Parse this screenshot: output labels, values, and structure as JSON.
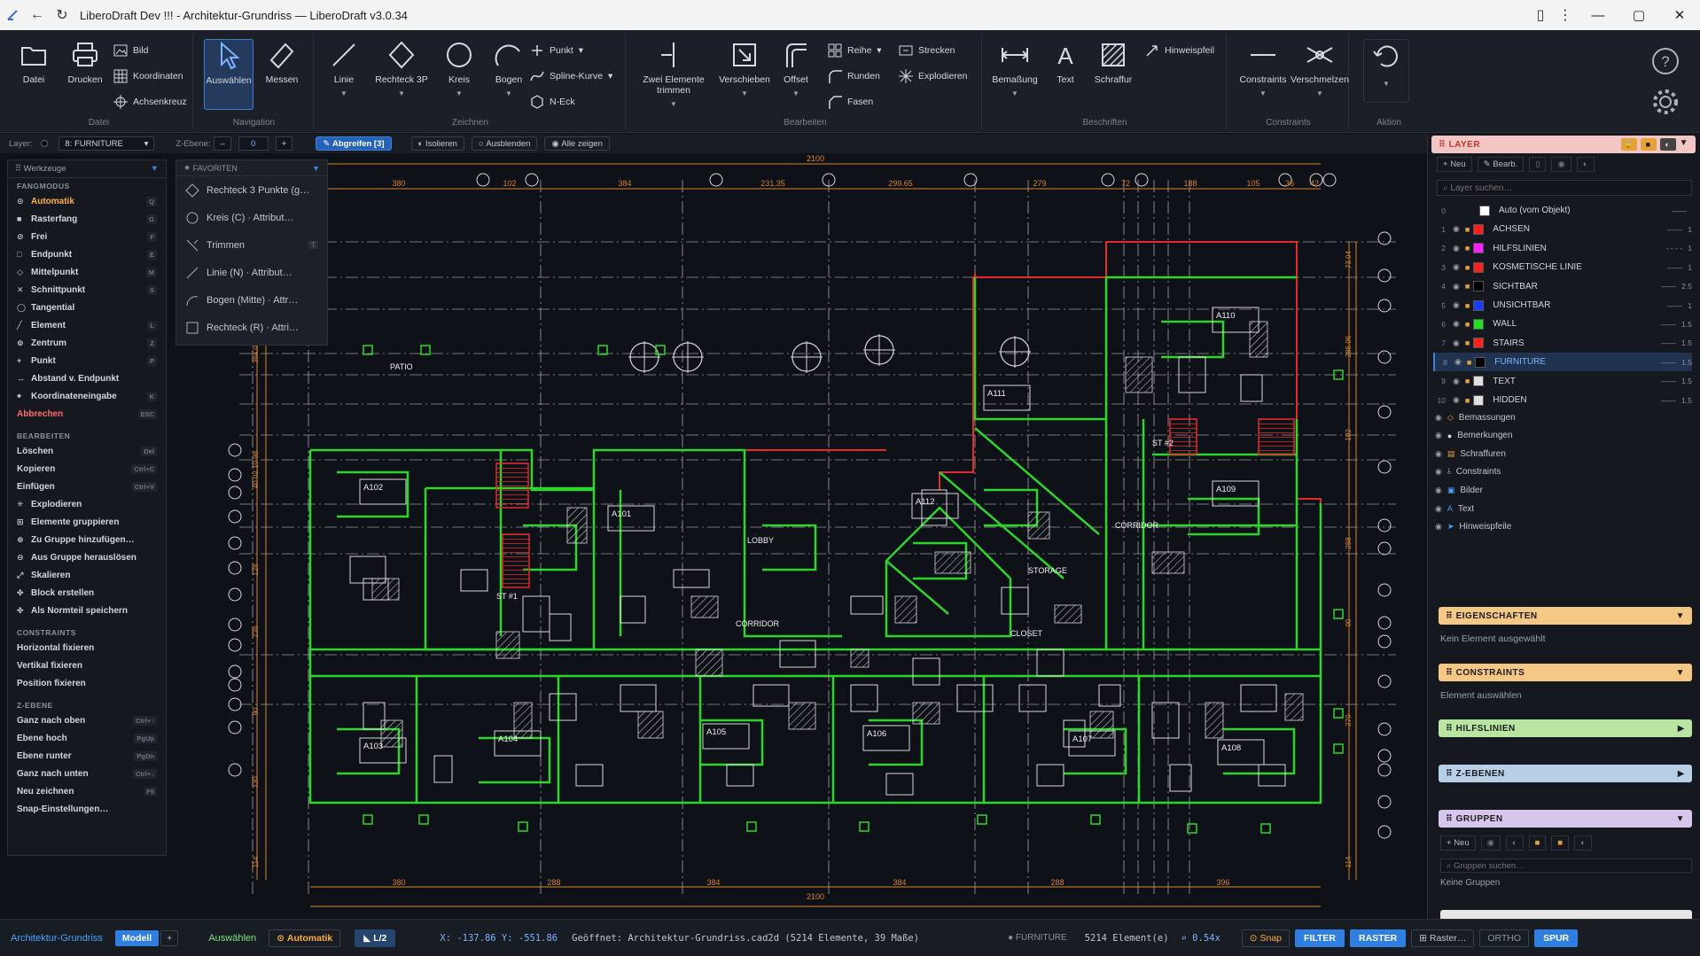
{
  "window": {
    "title": "LiberoDraft Dev !!! - Architektur-Grundriss — LiberoDraft v3.0.34",
    "controls": [
      "minimize",
      "maximize",
      "close"
    ]
  },
  "ribbon": {
    "groups": [
      {
        "label": "Datei",
        "items": [
          {
            "label": "Datei",
            "icon": "folder-icon"
          },
          {
            "label": "Drucken",
            "icon": "printer-icon"
          },
          {
            "label": "Bild",
            "icon": "image-icon"
          },
          {
            "label": "Koordinaten",
            "icon": "grid-icon"
          },
          {
            "label": "Achsenkreuz",
            "icon": "crosshair-icon"
          }
        ]
      },
      {
        "label": "Navigation",
        "items": [
          {
            "label": "Auswählen",
            "icon": "cursor-icon",
            "active": true
          },
          {
            "label": "Messen",
            "icon": "ruler-icon"
          }
        ]
      },
      {
        "label": "Zeichnen",
        "items": [
          {
            "label": "Linie",
            "icon": "line-icon"
          },
          {
            "label": "Rechteck 3P",
            "icon": "diamond-icon"
          },
          {
            "label": "Kreis",
            "icon": "circle-icon"
          },
          {
            "label": "Bogen",
            "icon": "arc-icon"
          },
          {
            "label": "Punkt",
            "icon": "plus-icon"
          },
          {
            "label": "Spline-Kurve",
            "icon": "spline-icon"
          },
          {
            "label": "N-Eck",
            "icon": "hexagon-icon"
          }
        ]
      },
      {
        "label": "Bearbeiten",
        "items": [
          {
            "label": "Zwei Elemente trimmen",
            "icon": "trim-icon"
          },
          {
            "label": "Verschieben",
            "icon": "move-icon"
          },
          {
            "label": "Offset",
            "icon": "offset-icon"
          },
          {
            "label": "Reihe",
            "icon": "array-icon"
          },
          {
            "label": "Runden",
            "icon": "fillet-icon"
          },
          {
            "label": "Fasen",
            "icon": "chamfer-icon"
          },
          {
            "label": "Strecken",
            "icon": "stretch-icon"
          },
          {
            "label": "Explodieren",
            "icon": "explode-icon"
          }
        ]
      },
      {
        "label": "Beschriften",
        "items": [
          {
            "label": "Bemaßung",
            "icon": "dimension-icon"
          },
          {
            "label": "Text",
            "icon": "text-icon"
          },
          {
            "label": "Schraffur",
            "icon": "hatch-icon"
          },
          {
            "label": "Hinweispfeil",
            "icon": "leader-icon"
          }
        ]
      },
      {
        "label": "Constraints",
        "items": [
          {
            "label": "Constraints",
            "icon": "constraint-icon"
          },
          {
            "label": "Verschmelzen",
            "icon": "merge-icon"
          }
        ]
      },
      {
        "label": "Aktion",
        "items": [
          {
            "label": "",
            "icon": "undo-icon"
          }
        ]
      }
    ],
    "help_icon": "help-icon",
    "settings_icon": "gear-icon"
  },
  "optbar": {
    "layer_label": "Layer:",
    "layer_value": "8: FURNITURE",
    "z_label": "Z-Ebene:",
    "z_minus": "–",
    "z_value": "0",
    "z_plus": "+",
    "grab": "Abgreifen [3]",
    "isolate": "Isolieren",
    "hide": "Ausblenden",
    "showall": "Alle zeigen"
  },
  "tools": {
    "header": "Werkzeuge",
    "sections": [
      {
        "title": "FANGMODUS",
        "items": [
          {
            "label": "Automatik",
            "key": "Q",
            "style": "orange"
          },
          {
            "label": "Rasterfang",
            "key": "G"
          },
          {
            "label": "Frei",
            "key": "F"
          },
          {
            "label": "Endpunkt",
            "key": "E"
          },
          {
            "label": "Mittelpunkt",
            "key": "M"
          },
          {
            "label": "Schnittpunkt",
            "key": "S"
          },
          {
            "label": "Tangential",
            "key": ""
          },
          {
            "label": "Element",
            "key": "L"
          },
          {
            "label": "Zentrum",
            "key": "Z"
          },
          {
            "label": "Punkt",
            "key": "P"
          },
          {
            "label": "Abstand v. Endpunkt",
            "key": ""
          },
          {
            "label": "Koordinateneingabe",
            "key": "K"
          },
          {
            "label": "Abbrechen",
            "key": "ESC",
            "style": "red"
          }
        ]
      },
      {
        "title": "BEARBEITEN",
        "items": [
          {
            "label": "Löschen",
            "key": "Del"
          },
          {
            "label": "Kopieren",
            "key": "Ctrl+C"
          },
          {
            "label": "Einfügen",
            "key": "Ctrl+V"
          },
          {
            "label": "Explodieren",
            "key": ""
          },
          {
            "label": "Elemente gruppieren",
            "key": ""
          },
          {
            "label": "Zu Gruppe hinzufügen…",
            "key": ""
          },
          {
            "label": "Aus Gruppe herauslösen",
            "key": ""
          },
          {
            "label": "Skalieren",
            "key": ""
          },
          {
            "label": "Block erstellen",
            "key": ""
          },
          {
            "label": "Als Normteil speichern",
            "key": ""
          }
        ]
      },
      {
        "title": "CONSTRAINTS",
        "items": [
          {
            "label": "Horizontal fixieren",
            "key": ""
          },
          {
            "label": "Vertikal fixieren",
            "key": ""
          },
          {
            "label": "Position fixieren",
            "key": ""
          }
        ]
      },
      {
        "title": "Z-EBENE",
        "items": [
          {
            "label": "Ganz nach oben",
            "key": "Ctrl+↑"
          },
          {
            "label": "Ebene hoch",
            "key": "PgUp"
          },
          {
            "label": "Ebene runter",
            "key": "PgDn"
          },
          {
            "label": "Ganz nach unten",
            "key": "Ctrl+↓"
          },
          {
            "label": "Neu zeichnen",
            "key": "F5"
          },
          {
            "label": "Snap-Einstellungen…",
            "key": ""
          }
        ]
      }
    ]
  },
  "favorites": {
    "header": "FAVORITEN",
    "items": [
      "Rechteck 3 Punkte (g…",
      "Kreis (C) · Attribut…",
      "Trimmen",
      "Linie (N) · Attribut…",
      "Bogen (Mitte) · Attr…",
      "Rechteck (R) · Attri…"
    ]
  },
  "drawing": {
    "dims_top": [
      "380",
      "102",
      "384",
      "231.35",
      "299.65",
      "279",
      "72",
      "188",
      "105",
      "36",
      "42"
    ],
    "dim_total": "2100",
    "dims_bottom": [
      "380",
      "288",
      "384",
      "384",
      "288",
      "396"
    ],
    "dims_left": [
      "364.06",
      "40 02 10 98",
      "128",
      "236",
      "90",
      "330",
      "114"
    ],
    "dims_right": [
      "73.04",
      "286.96",
      "102",
      "288",
      "90",
      "270",
      "114"
    ],
    "rooms": [
      "A101",
      "A102",
      "A103",
      "A104",
      "A105",
      "A106",
      "A107",
      "A108",
      "A109",
      "A110",
      "A111",
      "A112"
    ],
    "labels": [
      "LOBBY",
      "CORRIDOR",
      "STORAGE",
      "CLOSET",
      "CORRIDOR",
      "ST #1",
      "ST #2",
      "PATIO"
    ]
  },
  "layers": {
    "title": "LAYER",
    "new": "Neu",
    "edit": "Bearb.",
    "search_placeholder": "Layer suchen…",
    "items": [
      {
        "num": "0",
        "name": "Auto (vom Objekt)",
        "color": "#ffffff",
        "w": ""
      },
      {
        "num": "1",
        "name": "ACHSEN",
        "color": "#ff2020",
        "w": "1"
      },
      {
        "num": "2",
        "name": "HILFSLINIEN",
        "color": "#ff20ff",
        "w": "1"
      },
      {
        "num": "3",
        "name": "KOSMETISCHE LINIE",
        "color": "#ff2020",
        "w": "1"
      },
      {
        "num": "4",
        "name": "SICHTBAR",
        "color": "#000000",
        "w": "2.5"
      },
      {
        "num": "5",
        "name": "UNSICHTBAR",
        "color": "#1a3cff",
        "w": "1"
      },
      {
        "num": "6",
        "name": "WALL",
        "color": "#20e020",
        "w": "1.5"
      },
      {
        "num": "7",
        "name": "STAIRS",
        "color": "#ff2020",
        "w": "1.5"
      },
      {
        "num": "8",
        "name": "FURNITURE",
        "color": "#000000",
        "w": "1.5",
        "selected": true
      },
      {
        "num": "9",
        "name": "TEXT",
        "color": "#e0e0e0",
        "w": "1.5"
      },
      {
        "num": "10",
        "name": "HIDDEN",
        "color": "#e0e0e0",
        "w": "1.5"
      }
    ],
    "sublayers": [
      "Bemassungen",
      "Bemerkungen",
      "Schraffuren",
      "Constraints",
      "Bilder",
      "Text",
      "Hinweispfeile"
    ]
  },
  "panels": {
    "eigenschaften": {
      "title": "EIGENSCHAFTEN",
      "note": "Kein Element ausgewählt"
    },
    "constraints": {
      "title": "CONSTRAINTS",
      "note": "Element auswählen"
    },
    "hilfslinien": {
      "title": "HILFSLINIEN"
    },
    "zebenen": {
      "title": "Z-EBENEN"
    },
    "gruppen": {
      "title": "GRUPPEN",
      "new": "Neu",
      "search_placeholder": "Gruppen suchen…",
      "note": "Keine Gruppen"
    }
  },
  "status": {
    "tab": "Architektur-Grundriss",
    "model": "Modell",
    "plus": "+",
    "mode": "Auswählen",
    "snap": "Automatik",
    "grid": "L/2",
    "coords": "X: -137.86 Y: -551.86",
    "file": "Geöffnet: Architektur-Grundriss.cad2d (5214 Elemente, 39 Maße)",
    "layer": "FURNITURE",
    "count": "5214 Element(e)",
    "zoom": "0.54x",
    "buttons": [
      "Snap",
      "FILTER",
      "RASTER",
      "Raster…",
      "ORTHO",
      "SPUR"
    ]
  }
}
